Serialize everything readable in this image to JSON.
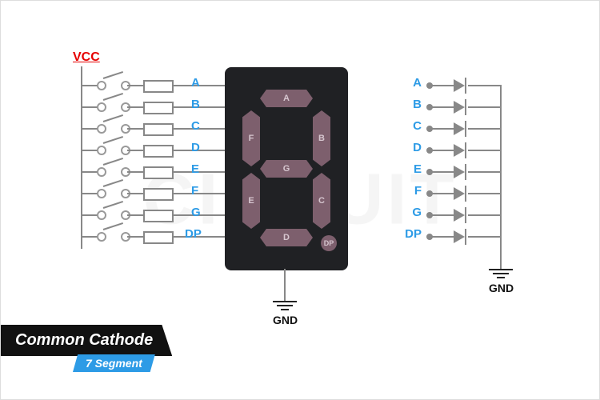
{
  "title_main": "Common Cathode",
  "title_sub": "7 Segment",
  "power_label": "VCC",
  "ground_label": "GND",
  "segments": [
    "A",
    "B",
    "C",
    "D",
    "E",
    "F",
    "G",
    "DP"
  ],
  "segment_positions": {
    "A": "top-horizontal",
    "B": "top-right-vertical",
    "C": "bottom-right-vertical",
    "D": "bottom-horizontal",
    "E": "bottom-left-vertical",
    "F": "top-left-vertical",
    "G": "middle-horizontal",
    "DP": "decimal-point"
  },
  "left_side": {
    "description": "VCC rail -> switch -> resistor -> segment pin (x8)",
    "pins": [
      "A",
      "B",
      "C",
      "D",
      "E",
      "F",
      "G",
      "DP"
    ]
  },
  "right_side": {
    "description": "pin -> diode (LED) -> common cathode bus -> GND",
    "pins": [
      "A",
      "B",
      "C",
      "D",
      "E",
      "F",
      "G",
      "DP"
    ]
  },
  "display_type": "common-cathode-7-segment",
  "colors": {
    "pin_label": "#2d9be6",
    "vcc": "#e60000",
    "segment_fill": "#7d5f6d",
    "module_body": "#202124",
    "wire": "#888888"
  }
}
